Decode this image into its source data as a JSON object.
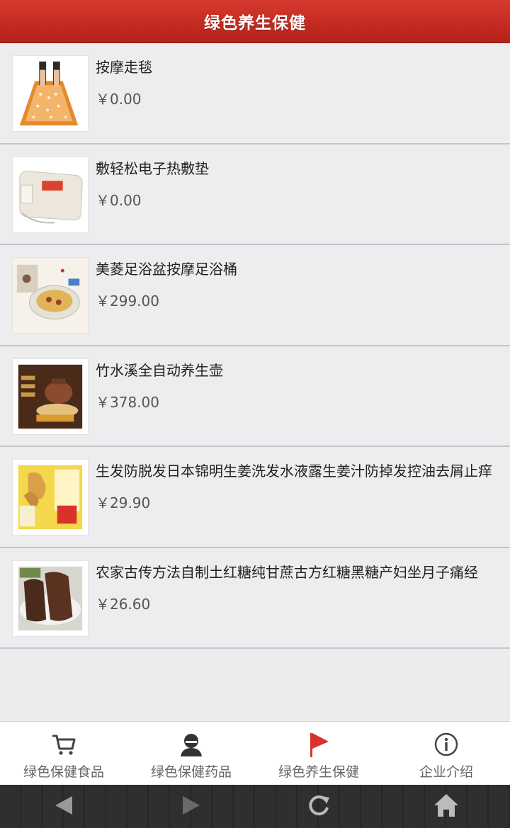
{
  "header": {
    "title": "绿色养生保健"
  },
  "products": [
    {
      "title": "按摩走毯",
      "price": "￥0.00"
    },
    {
      "title": "敷轻松电子热敷垫",
      "price": "￥0.00"
    },
    {
      "title": "美菱足浴盆按摩足浴桶",
      "price": "￥299.00"
    },
    {
      "title": "竹水溪全自动养生壶",
      "price": "￥378.00"
    },
    {
      "title": "生发防脱发日本锦明生姜洗发水液露生姜汁防掉发控油去屑止痒",
      "price": "￥29.90"
    },
    {
      "title": "农家古传方法自制土红糖纯甘蔗古方红糖黑糖产妇坐月子痛经",
      "price": "￥26.60"
    }
  ],
  "tabs": [
    {
      "label": "绿色保健食品",
      "icon": "cart-icon"
    },
    {
      "label": "绿色保健药品",
      "icon": "person-icon"
    },
    {
      "label": "绿色养生保健",
      "icon": "flag-icon"
    },
    {
      "label": "企业介绍",
      "icon": "info-icon"
    }
  ],
  "colors": {
    "header": "#c22a21",
    "active_tab": "#d9322b"
  },
  "system_nav": [
    "back-icon",
    "forward-icon",
    "refresh-icon",
    "home-icon"
  ]
}
